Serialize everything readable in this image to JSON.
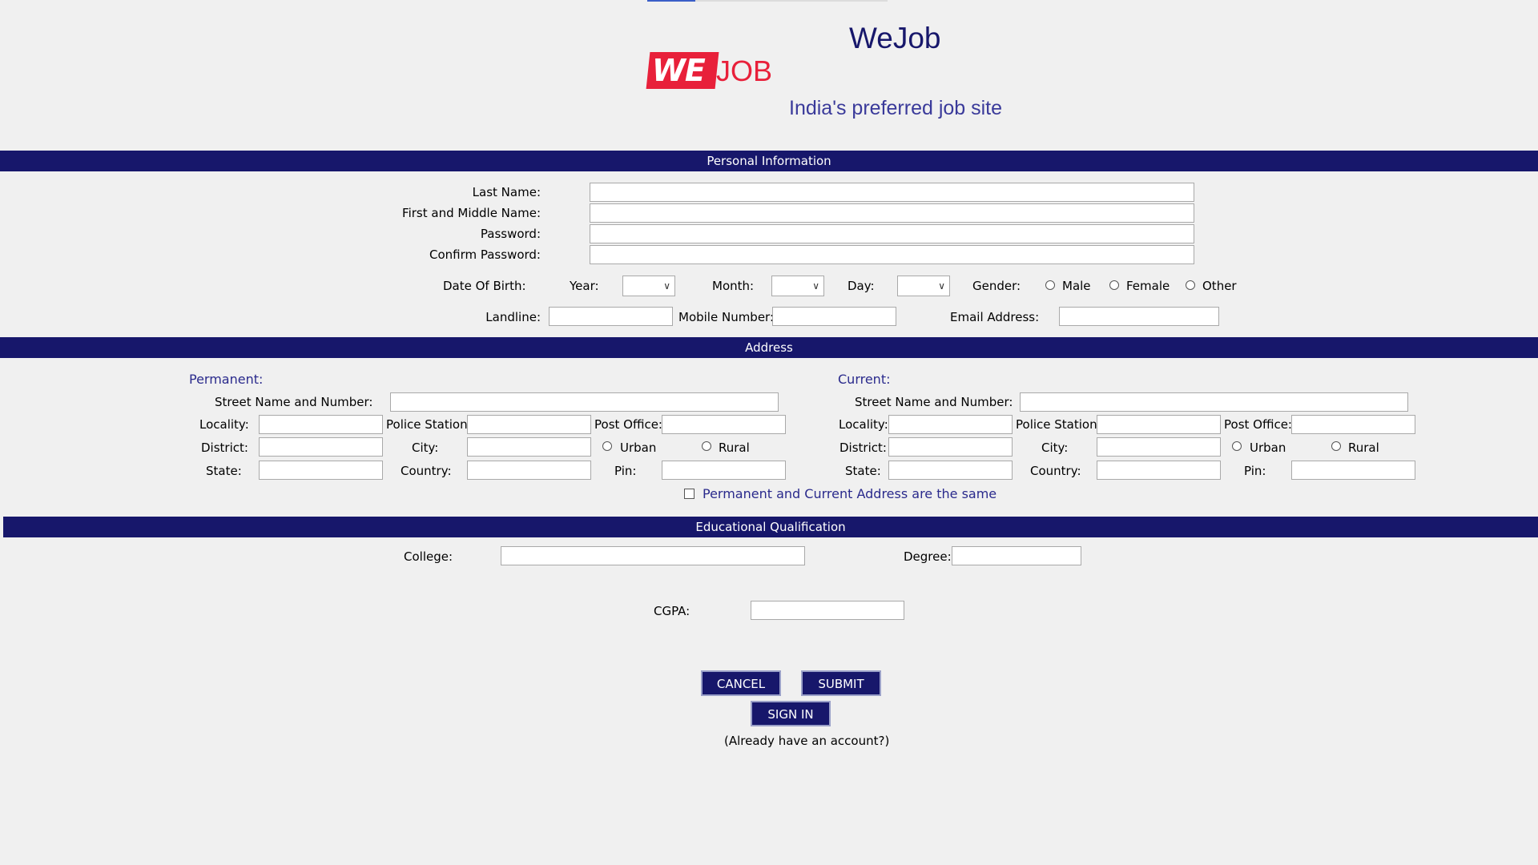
{
  "header": {
    "logo_we": "WE",
    "logo_job": "JOB",
    "title": "WeJob",
    "tagline": "India's preferred job site"
  },
  "personal": {
    "section_title": "Personal Information",
    "last_name_label": "Last Name:",
    "first_middle_label": "First and Middle Name:",
    "password_label": "Password:",
    "confirm_password_label": "Confirm Password:",
    "dob_label": "Date Of Birth:",
    "year_label": "Year:",
    "month_label": "Month:",
    "day_label": "Day:",
    "gender_label": "Gender:",
    "gender_options": [
      "Male",
      "Female",
      "Other"
    ],
    "landline_label": "Landline:",
    "mobile_label": "Mobile Number:",
    "email_label": "Email Address:"
  },
  "address": {
    "section_title": "Address",
    "permanent": {
      "heading": "Permanent:",
      "street_label": "Street Name and Number:",
      "locality_label": "Locality:",
      "police_label": "Police Station:",
      "post_label": "Post Office:",
      "district_label": "District:",
      "city_label": "City:",
      "urban_label": "Urban",
      "rural_label": "Rural",
      "state_label": "State:",
      "country_label": "Country:",
      "pin_label": "Pin:"
    },
    "current": {
      "heading": "Current:",
      "street_label": "Street Name and Number:",
      "locality_label": "Locality:",
      "police_label": "Police Station:",
      "post_label": "Post Office:",
      "district_label": "District:",
      "city_label": "City:",
      "urban_label": "Urban",
      "rural_label": "Rural",
      "state_label": "State:",
      "country_label": "Country:",
      "pin_label": "Pin:"
    },
    "same_address_label": "Permanent and Current Address are the same"
  },
  "education": {
    "section_title": "Educational Qualification",
    "college_label": "College:",
    "degree_label": "Degree:",
    "cgpa_label": "CGPA:"
  },
  "actions": {
    "cancel_label": "CANCEL",
    "submit_label": "SUBMIT",
    "signin_label": "SIGN IN",
    "already_account": "(Already have an account?)"
  },
  "colors": {
    "band": "#17176b",
    "logo_red": "#e8203a",
    "heading_blue": "#2a2a8c",
    "background": "#f0f0f0"
  }
}
